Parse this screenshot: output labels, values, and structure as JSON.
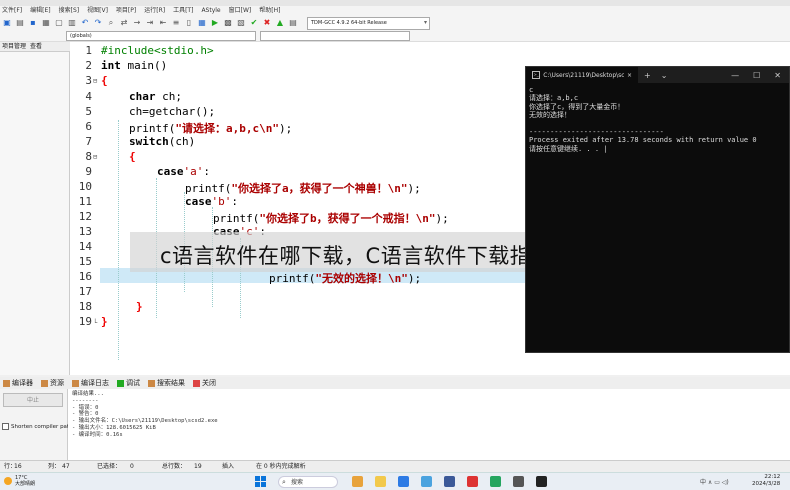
{
  "menu": [
    "文件[F]",
    "编辑[E]",
    "搜索[S]",
    "视图[V]",
    "项目[P]",
    "运行[R]",
    "工具[T]",
    "AStyle",
    "窗口[W]",
    "帮助[H]"
  ],
  "toolbar": {
    "compiler": "TDM-GCC 4.9.2 64-bit Release",
    "globals": "(globals)"
  },
  "left_panel": {
    "tab_project": "项目管理",
    "tab_view": "查看"
  },
  "editor": {
    "line_numbers": [
      "1",
      "2",
      "3",
      "4",
      "5",
      "6",
      "7",
      "8",
      "9",
      "10",
      "11",
      "12",
      "13",
      "14",
      "15",
      "16",
      "17",
      "18",
      "19"
    ],
    "code": {
      "l1": "#include<stdio.h>",
      "l2_kw": "int",
      "l2_rest": " main()",
      "l3": "{",
      "l4_kw": "char",
      "l4_rest": " ch;",
      "l5": "ch=getchar();",
      "l6_a": "printf(",
      "l6_s": "\"请选择：a,b,c\\n\"",
      "l6_b": ");",
      "l7_kw": "switch",
      "l7_rest": "(ch)",
      "l8": "{",
      "l9_kw": "case",
      "l9_c": "'a'",
      "l9_rest": ":",
      "l10_a": "printf(",
      "l10_s": "\"你选择了a，获得了一个神兽！\\n\"",
      "l10_b": ");",
      "l11_kw": "case",
      "l11_c": "'b'",
      "l11_rest": ":",
      "l12_a": "printf(",
      "l12_s": "\"你选择了b，获得了一个戒指！\\n\"",
      "l12_b": ");",
      "l13_kw": "case",
      "l13_c": "'c'",
      "l13_rest": ":",
      "l16_a": "printf(",
      "l16_s": "\"无效的选择！\\n",
      "l16_q": "\"",
      "l16_b": ");",
      "l18": "}",
      "l19": "}"
    }
  },
  "banner": "c语言软件在哪下载，C语言软件下载指南",
  "console": {
    "tab_title": "C:\\Users\\21119\\Desktop\\scsd:",
    "add": "+",
    "dropdown": "⌄",
    "minimize": "—",
    "maximize": "☐",
    "close": "✕",
    "output": "c\n请选择：a,b,c\n你选择了c，得到了大量金币！\n无效的选择！\n\n--------------------------------\nProcess exited after 13.78 seconds with return value 0\n请按任意键继续. . . |"
  },
  "bottom_tabs": [
    "编译器",
    "资源",
    "编译日志",
    "调试",
    "搜索结果",
    "关闭"
  ],
  "bottom_left": {
    "abort": "中止",
    "shorten": "Shorten compiler paths"
  },
  "compile_log": "编译结果...\n--------\n- 错误：0\n- 警告：0\n- 输出文件名：C:\\Users\\21119\\Desktop\\scsd2.exe\n- 输出大小：128.6015625 KiB\n- 编译时间：0.16s",
  "statusbar": {
    "row_label": "行：",
    "row_value": "16",
    "col_label": "列：",
    "col_value": "47",
    "sel_label": "已选择：",
    "sel_value": "0",
    "total_label": "总行数：",
    "total_value": "19",
    "mode": "插入",
    "parse": "在 0 秒内完成解析"
  },
  "taskbar": {
    "temperature": "17°C",
    "weather": "大部晴朗",
    "search": "搜索",
    "tray": "中  ∧  ▭  ◁)",
    "time": "22:12",
    "date": "2024/3/28"
  }
}
